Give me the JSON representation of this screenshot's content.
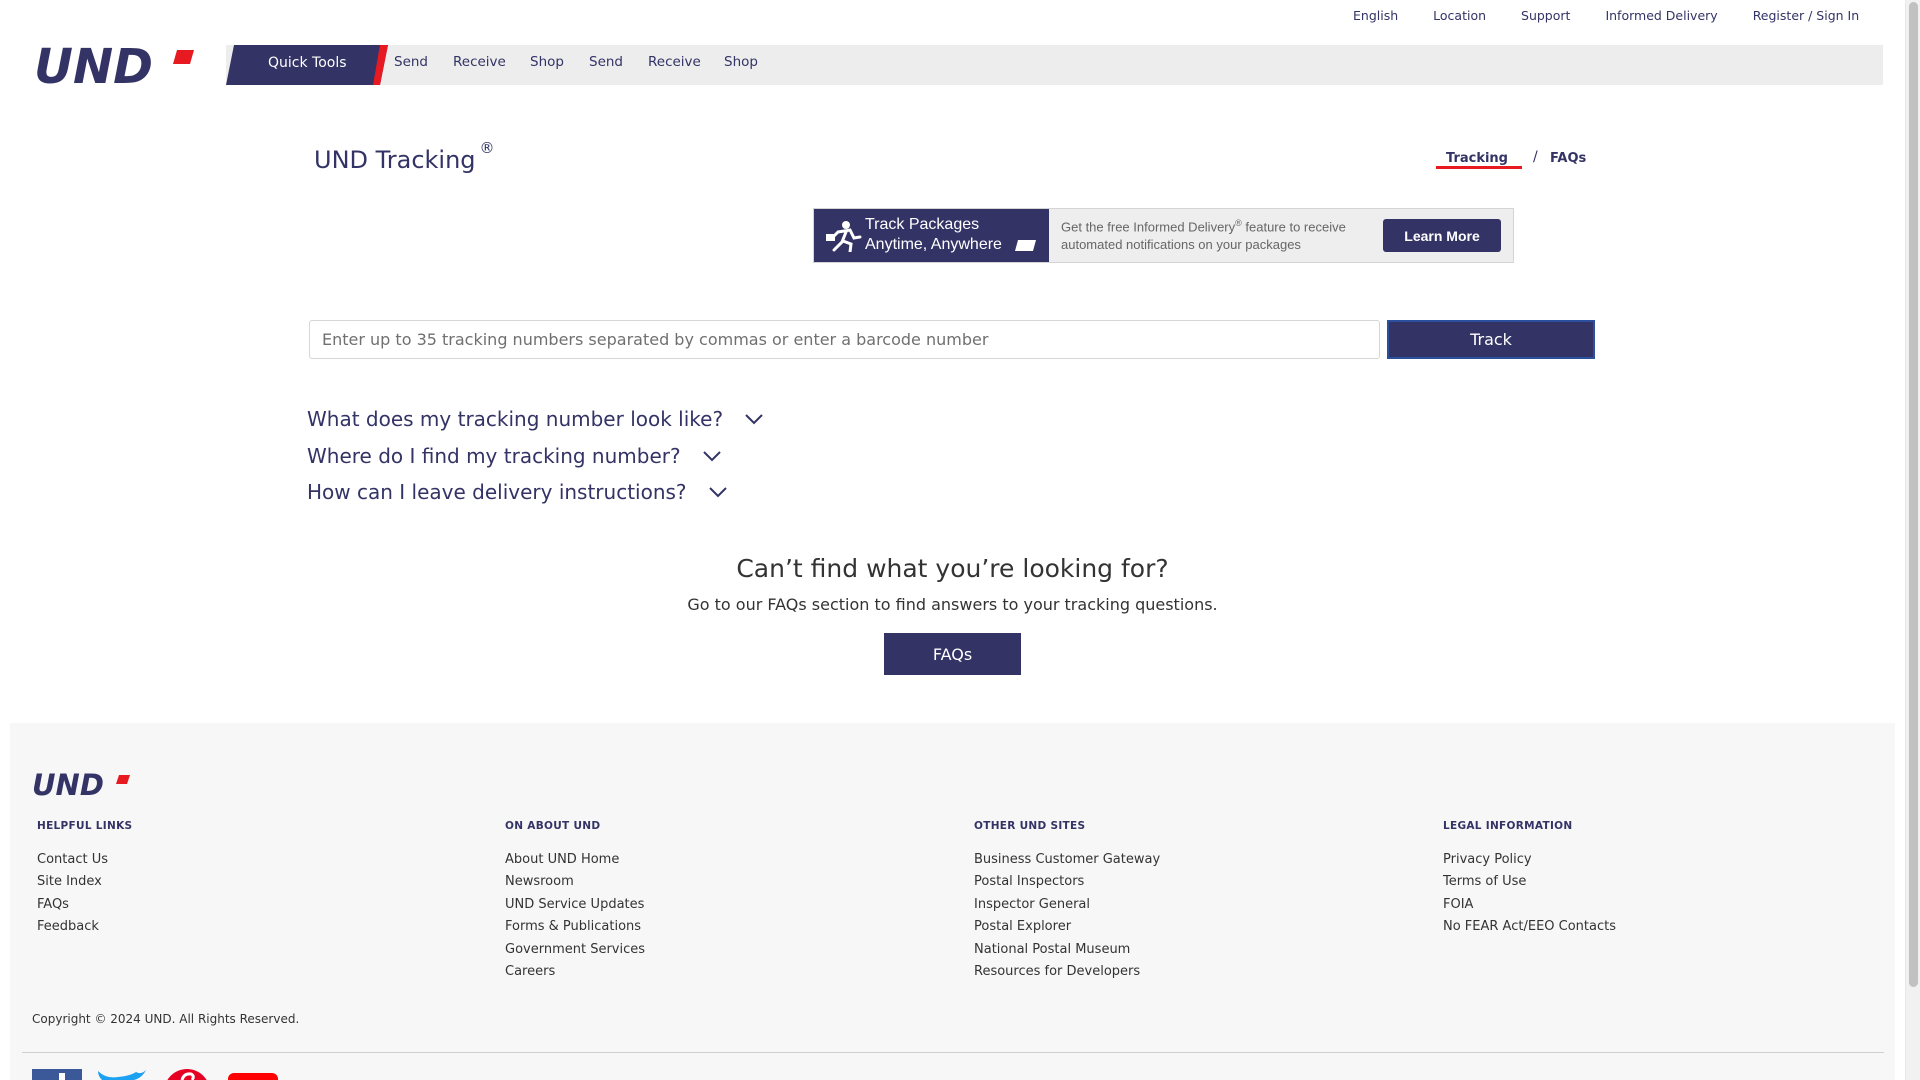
{
  "top_links": [
    "English",
    "Location",
    "Support",
    "Informed Delivery",
    "Register / Sign In"
  ],
  "logo_text": "UND",
  "nav": {
    "quick_tools": "Quick Tools",
    "items": [
      "Send",
      "Receive",
      "Shop",
      "Send",
      "Receive",
      "Shop"
    ]
  },
  "page": {
    "title": "UND Tracking",
    "title_mark": "®"
  },
  "breadcrumb": {
    "tracking": "Tracking",
    "separator": "/",
    "faqs": "FAQs"
  },
  "banner": {
    "line1": "Track Packages",
    "line2": "Anytime, Anywhere",
    "copy_line1_a": "Get the free Informed Delivery",
    "copy_line1_mark": "®",
    "copy_line1_b": " feature to receive",
    "copy_line2": "automated notifications on your packages",
    "button": "Learn More"
  },
  "tracking": {
    "placeholder": "Enter up to 35 tracking numbers separated by commas or enter a barcode number",
    "value": "",
    "button": "Track"
  },
  "faqs": [
    "What does my tracking number look like?",
    "Where do I find my tracking number?",
    "How can I leave delivery instructions?"
  ],
  "help": {
    "heading": "Can’t find what you’re looking for?",
    "subtext": "Go to our FAQs section to find answers to your tracking questions.",
    "button": "FAQs"
  },
  "footer": {
    "columns": [
      {
        "heading": "HELPFUL LINKS",
        "links": [
          "Contact Us",
          "Site Index",
          "FAQs",
          "Feedback"
        ]
      },
      {
        "heading": "ON ABOUT UND",
        "links": [
          "About UND Home",
          "Newsroom",
          "UND Service Updates",
          "Forms & Publications",
          "Government Services",
          "Careers"
        ]
      },
      {
        "heading": "OTHER UND SITES",
        "links": [
          "Business Customer Gateway",
          "Postal Inspectors",
          "Inspector General",
          "Postal Explorer",
          "National Postal Museum",
          "Resources for Developers"
        ]
      },
      {
        "heading": "LEGAL INFORMATION",
        "links": [
          "Privacy Policy",
          "Terms of Use",
          "FOIA",
          "No FEAR Act/EEO Contacts"
        ]
      }
    ],
    "copyright": "Copyright © 2024 UND. All Rights Reserved.",
    "social_icons": [
      "facebook-icon",
      "twitter-icon",
      "pinterest-icon",
      "youtube-icon"
    ]
  },
  "colors": {
    "brand_navy": "#333366",
    "brand_red": "#e71921",
    "nav_background": "#ededed",
    "footer_background": "#f7f7f7"
  }
}
